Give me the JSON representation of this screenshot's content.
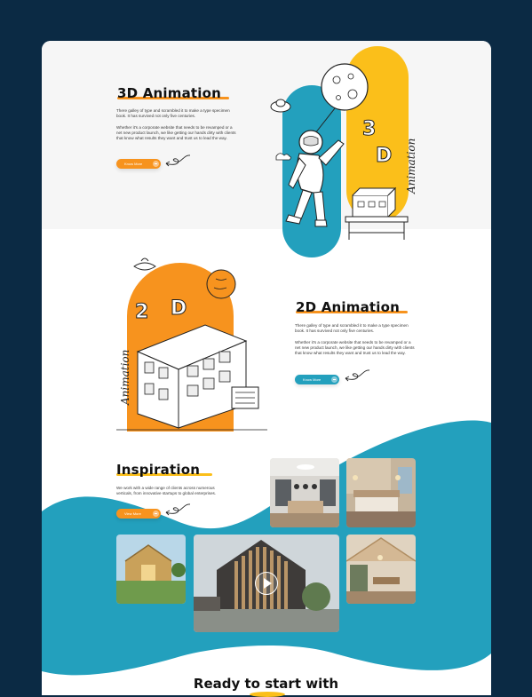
{
  "section_3d": {
    "title": "3D Animation",
    "para1": "There galley of type and scrambled it to make a type specimen book. It has survived not only five centuries.",
    "para2": "Whether it's a corporate website that needs to be revamped or a net new product launch, we like getting our hands dirty with clients that know what results they want and trust us to lead the way.",
    "button_label": "Know More",
    "art_label_3": "3",
    "art_label_d": "D",
    "art_vertical": "Animation"
  },
  "section_2d": {
    "title": "2D Animation",
    "para1": "There galley of type and scrambled it to make a type specimen book. It has survived not only five centuries.",
    "para2": "Whether it's a corporate website that needs to be revamped or a net new product launch, we like getting our hands dirty with clients that know what results they want and trust us to lead the way.",
    "button_label": "Know More",
    "art_label_2": "2",
    "art_label_d": "D",
    "art_vertical": "Animation"
  },
  "inspiration": {
    "title": "Inspiration",
    "para": "We work with a wide range of clients across numerous verticals, from innovative startups to global enterprises.",
    "button_label": "View More"
  },
  "footer": {
    "title": "Ready to start with"
  },
  "colors": {
    "navy": "#0b2a44",
    "teal": "#23a0bd",
    "orange": "#f7931e",
    "yellow": "#fbbf1a"
  }
}
